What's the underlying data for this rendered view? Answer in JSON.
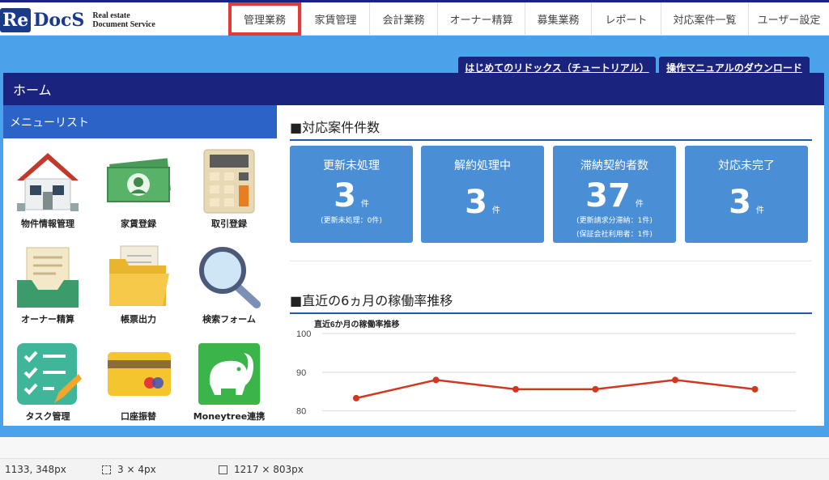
{
  "logo": {
    "re": "Re",
    "docs": "DocS",
    "tag_line1": "Real estate",
    "tag_line2": "Document Service"
  },
  "nav": {
    "items": [
      {
        "label": "管理業務",
        "active": true
      },
      {
        "label": "家賃管理",
        "active": false
      },
      {
        "label": "会計業務",
        "active": false
      },
      {
        "label": "オーナー精算",
        "active": false
      },
      {
        "label": "募集業務",
        "active": false
      },
      {
        "label": "レポート",
        "active": false
      },
      {
        "label": "対応案件一覧",
        "active": false
      },
      {
        "label": "ユーザー設定",
        "active": false
      }
    ]
  },
  "tabs": {
    "tutorial": "はじめてのリドックス（チュートリアル）",
    "manual": "操作マニュアルのダウンロード"
  },
  "home": {
    "title": "ホーム"
  },
  "menu": {
    "title": "メニューリスト",
    "items": [
      {
        "label": "物件情報管理",
        "icon": "house-icon"
      },
      {
        "label": "家賃登録",
        "icon": "banknote-icon"
      },
      {
        "label": "取引登録",
        "icon": "calculator-icon"
      },
      {
        "label": "オーナー精算",
        "icon": "inbox-tray-icon"
      },
      {
        "label": "帳票出力",
        "icon": "folder-icon"
      },
      {
        "label": "検索フォーム",
        "icon": "magnifier-icon"
      },
      {
        "label": "タスク管理",
        "icon": "checklist-icon"
      },
      {
        "label": "口座振替",
        "icon": "credit-card-icon"
      },
      {
        "label": "Moneytree連携",
        "icon": "moneytree-elephant-icon"
      }
    ]
  },
  "cases": {
    "title": "■対応案件件数",
    "cards": [
      {
        "title": "更新未処理",
        "value": "3",
        "unit": "件",
        "sub": [
          "(更新未処理：0件)"
        ]
      },
      {
        "title": "解約処理中",
        "value": "3",
        "unit": "件",
        "sub": []
      },
      {
        "title": "滞納契約者数",
        "value": "37",
        "unit": "件",
        "sub": [
          "(更新請求分滞納：1件)",
          "(保証会社利用者：1件)"
        ]
      },
      {
        "title": "対応未完了",
        "value": "3",
        "unit": "件",
        "sub": []
      }
    ]
  },
  "occupancy": {
    "title": "■直近の6ヵ月の稼働率推移",
    "chart_title": "直近6か月の稼働率推移"
  },
  "chart_data": {
    "type": "line",
    "title": "直近6か月の稼働率推移",
    "xlabel": "",
    "ylabel": "",
    "yticks": [
      100,
      90,
      80
    ],
    "ylim": [
      77,
      100
    ],
    "series": [
      {
        "values": [
          83.3,
          88.0,
          85.6,
          85.6,
          88.0,
          85.6
        ]
      }
    ],
    "color": "#d0391f",
    "grid": true
  },
  "status": {
    "coords": "1133, 348px",
    "selection": "3 × 4px",
    "size": "1217 × 803px"
  }
}
